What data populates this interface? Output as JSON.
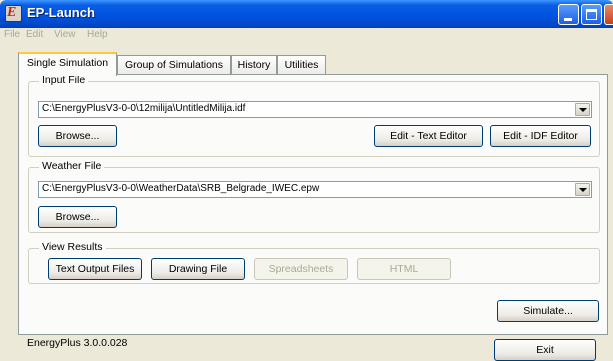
{
  "window": {
    "title": "EP-Launch",
    "icon": "ep-app-icon",
    "icon_letter": "E"
  },
  "menu": [
    "File",
    "Edit",
    "View",
    "Help"
  ],
  "tabs": [
    {
      "label": "Single Simulation",
      "active": true
    },
    {
      "label": "Group of Simulations",
      "active": false
    },
    {
      "label": "History",
      "active": false
    },
    {
      "label": "Utilities",
      "active": false
    }
  ],
  "input_file": {
    "legend": "Input File",
    "value": "C:\\EnergyPlusV3-0-0\\12milija\\UntitledMilija.idf",
    "browse_label": "Browse...",
    "edit_text_label": "Edit - Text Editor",
    "edit_idf_label": "Edit - IDF Editor"
  },
  "weather_file": {
    "legend": "Weather File",
    "value": "C:\\EnergyPlusV3-0-0\\WeatherData\\SRB_Belgrade_IWEC.epw",
    "browse_label": "Browse..."
  },
  "view_results": {
    "legend": "View Results",
    "buttons": [
      {
        "label": "Text Output Files",
        "enabled": true
      },
      {
        "label": "Drawing File",
        "enabled": true
      },
      {
        "label": "Spreadsheets",
        "enabled": false
      },
      {
        "label": "HTML",
        "enabled": false
      }
    ]
  },
  "simulate_label": "Simulate...",
  "status": "EnergyPlus 3.0.0.028",
  "exit_label": "Exit",
  "colors": {
    "titlebar": "#0053e0",
    "window_bg": "#ece9d8",
    "panel_bg": "#fbfbf9",
    "active_tab_accent": "#ffc83c",
    "button_border": "#003c74"
  }
}
